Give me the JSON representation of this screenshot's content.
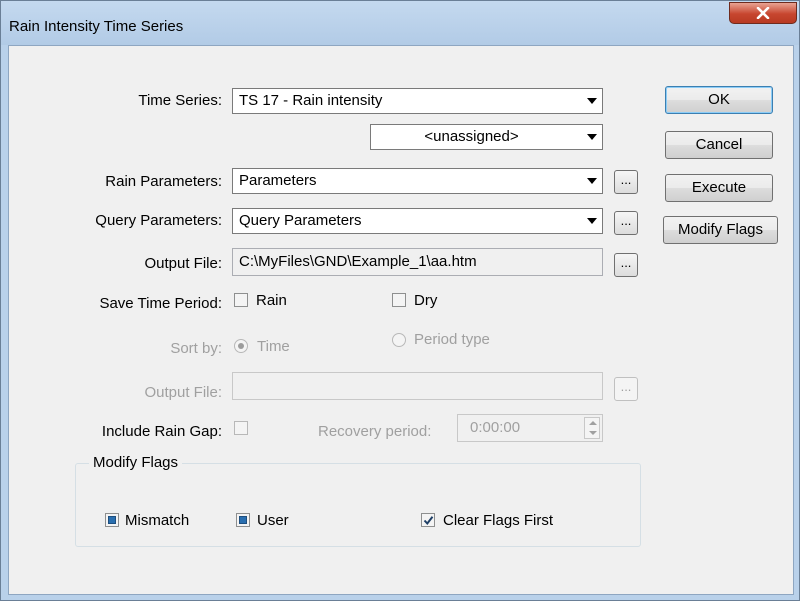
{
  "window": {
    "title": "Rain Intensity Time Series",
    "close_glyph": "x"
  },
  "form": {
    "time_series_label": "Time Series:",
    "time_series_value": "TS 17 - Rain intensity",
    "secondary_combo_value": "<unassigned>",
    "rain_params_label": "Rain Parameters:",
    "rain_params_value": "Parameters",
    "query_params_label": "Query Parameters:",
    "query_params_value": "Query Parameters",
    "output_file_label": "Output File:",
    "output_file_value": "C:\\MyFiles\\GND\\Example_1\\aa.htm",
    "save_period_label": "Save Time Period:",
    "rain_check_label": "Rain",
    "dry_check_label": "Dry",
    "sort_by_label": "Sort by:",
    "sort_time_label": "Time",
    "sort_period_label": "Period type",
    "output_file2_label": "Output File:",
    "output_file2_value": "",
    "include_gap_label": "Include Rain Gap:",
    "recovery_label": "Recovery period:",
    "recovery_value": "0:00:00",
    "browse_label": "..."
  },
  "buttons": {
    "ok": "OK",
    "cancel": "Cancel",
    "execute": "Execute",
    "modify_flags": "Modify Flags"
  },
  "flags_group": {
    "title": "Modify Flags",
    "mismatch_label": "Mismatch",
    "user_label": "User",
    "clear_first_label": "Clear Flags First"
  },
  "colors": {
    "title_bar": "#b9d1ea",
    "close_button": "#c7462f",
    "dialog_bg": "#f0f0f0",
    "flag_fill": "#2a6fb0"
  }
}
